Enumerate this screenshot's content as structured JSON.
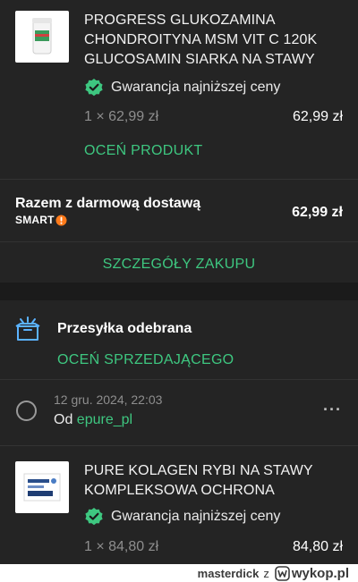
{
  "order1": {
    "product_title_lines": [
      "PROGRESS GLUKOZAMINA",
      "CHONDROITYNA MSM VIT C 120K",
      "GLUCOSAMIN SIARKA NA STAWY"
    ],
    "guarantee": "Gwarancja najniższej ceny",
    "qty_price": "1 × 62,99 zł",
    "line_total": "62,99 zł",
    "rate_product": "OCEŃ PRODUKT",
    "total_label": "Razem z darmową dostawą",
    "smart_label": "SMART",
    "total_value": "62,99 zł",
    "details_button": "SZCZEGÓŁY ZAKUPU"
  },
  "shipment": {
    "status": "Przesyłka odebrana",
    "rate_seller": "OCEŃ SPRZEDAJĄCEGO",
    "date": "12 gru. 2024, 22:03",
    "from_prefix": "Od",
    "seller": "epure_pl",
    "more": "···"
  },
  "order2": {
    "product_title_lines": [
      "PURE KOLAGEN RYBI NA STAWY",
      "KOMPLEKSOWA OCHRONA"
    ],
    "guarantee": "Gwarancja najniższej ceny",
    "qty_price": "1 × 84,80 zł",
    "line_total": "84,80 zł"
  },
  "watermark": {
    "user": "masterdick",
    "via": "z",
    "site": "wykop.pl"
  },
  "colors": {
    "accent": "#3ec780",
    "smart_badge": "#ff7a1a",
    "card": "#242424",
    "background": "#1b1b1b"
  }
}
